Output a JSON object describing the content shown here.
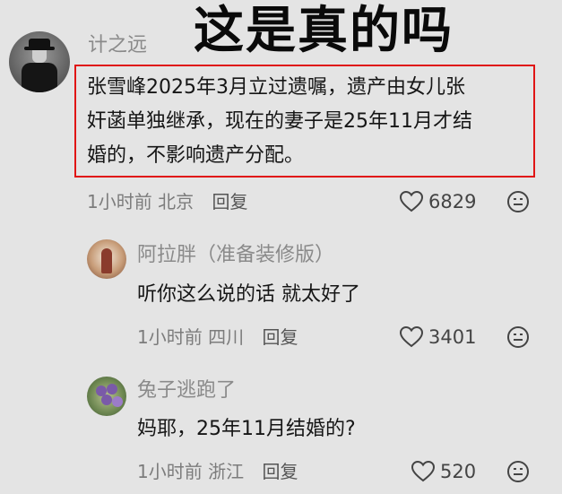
{
  "overlay_title": "这是真的吗",
  "comment": {
    "username": "计之远",
    "text_lines": [
      "张雪峰2025年3月立过遗嘱，遗产由女儿张",
      "奸菡单独继承，现在的妻子是25年11月才结",
      "婚的，不影响遗产分配。"
    ],
    "time": "1小时前",
    "location": "北京",
    "reply_label": "回复",
    "likes": "6829"
  },
  "replies": [
    {
      "username": "阿拉胖（准备装修版）",
      "text": "听你这么说的话 就太好了",
      "time": "1小时前",
      "location": "四川",
      "reply_label": "回复",
      "likes": "3401"
    },
    {
      "username": "兔子逃跑了",
      "text": "妈耶，25年11月结婚的?",
      "time": "1小时前",
      "location": "浙江",
      "reply_label": "回复",
      "likes": "520"
    }
  ],
  "colors": {
    "highlight_border": "#e01515",
    "background": "#e4e4e4"
  },
  "icons": [
    "heart-icon",
    "dislike-face-icon"
  ]
}
